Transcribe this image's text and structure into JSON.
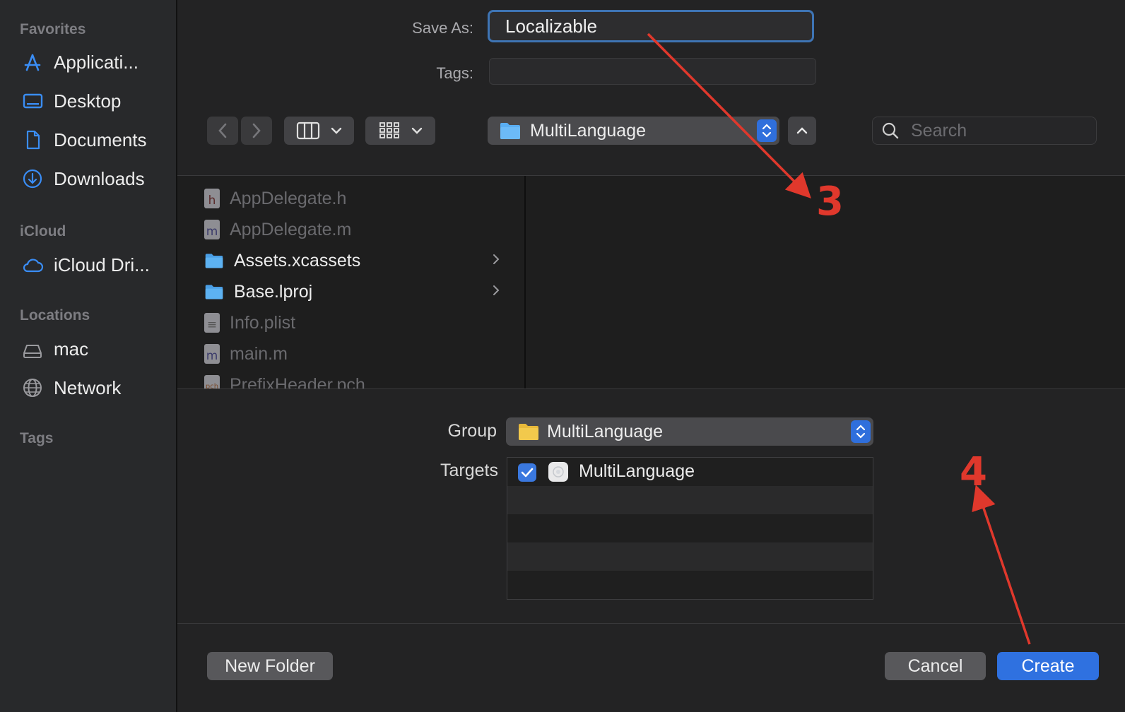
{
  "sidebar": {
    "favorites_header": "Favorites",
    "favorites": [
      {
        "label": "Applicati...",
        "icon": "applications-icon"
      },
      {
        "label": "Desktop",
        "icon": "desktop-icon"
      },
      {
        "label": "Documents",
        "icon": "document-icon"
      },
      {
        "label": "Downloads",
        "icon": "downloads-icon"
      }
    ],
    "icloud_header": "iCloud",
    "icloud": [
      {
        "label": "iCloud Dri...",
        "icon": "cloud-icon"
      }
    ],
    "locations_header": "Locations",
    "locations": [
      {
        "label": "mac",
        "icon": "drive-icon"
      },
      {
        "label": "Network",
        "icon": "globe-icon"
      }
    ],
    "tags_header": "Tags"
  },
  "form": {
    "save_as_label": "Save As:",
    "save_as_value": "Localizable",
    "tags_label": "Tags:"
  },
  "toolbar": {
    "location": "MultiLanguage",
    "search_placeholder": "Search"
  },
  "files": [
    {
      "name": "AppDelegate.h",
      "kind": "h",
      "enabled": false
    },
    {
      "name": "AppDelegate.m",
      "kind": "m",
      "enabled": false
    },
    {
      "name": "Assets.xcassets",
      "kind": "folder",
      "enabled": true
    },
    {
      "name": "Base.lproj",
      "kind": "folder",
      "enabled": true
    },
    {
      "name": "Info.plist",
      "kind": "plist",
      "enabled": false
    },
    {
      "name": "main.m",
      "kind": "m",
      "enabled": false
    },
    {
      "name": "PrefixHeader.pch",
      "kind": "pch",
      "enabled": false
    }
  ],
  "options": {
    "group_label": "Group",
    "group_value": "MultiLanguage",
    "targets_label": "Targets",
    "targets": [
      {
        "name": "MultiLanguage",
        "checked": true
      }
    ]
  },
  "buttons": {
    "new_folder": "New Folder",
    "cancel": "Cancel",
    "create": "Create"
  },
  "annotations": {
    "step3": "3",
    "step4": "4",
    "color": "#e0382c"
  },
  "colors": {
    "accent": "#2f71e0",
    "folder_blue": "#5aaef2",
    "folder_yellow": "#f2c94c"
  }
}
